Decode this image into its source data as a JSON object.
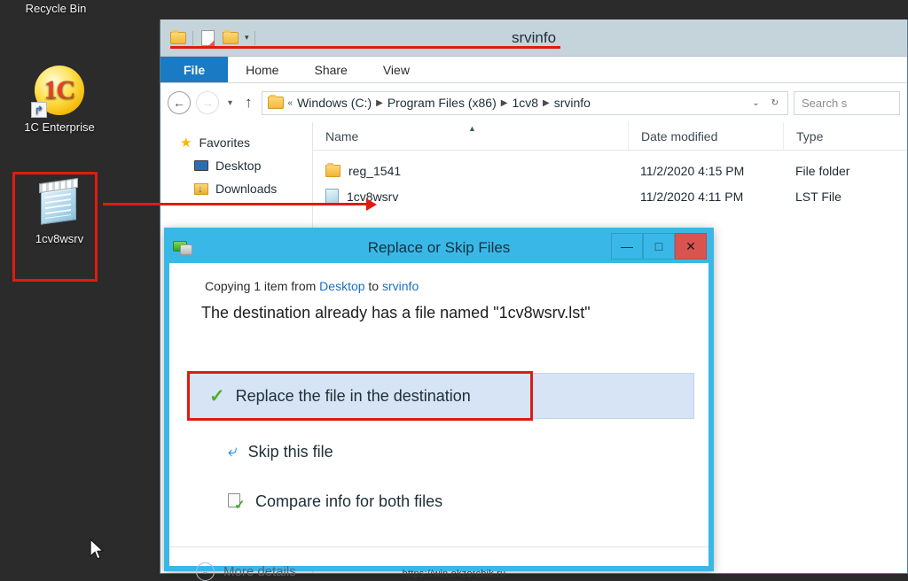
{
  "desktop": {
    "background_color": "#2b2b2b",
    "icons": [
      {
        "label": "Recycle Bin",
        "icon": "recycle-bin-icon"
      },
      {
        "label": "1C Enterprise",
        "icon": "1c-enterprise-icon",
        "logo_text": "1C",
        "shortcut_badge": "↱"
      },
      {
        "label": "1cv8wsrv",
        "icon": "lst-file-icon",
        "selected": true
      }
    ],
    "cursor": "mouse-pointer"
  },
  "explorer": {
    "title": "srvinfo",
    "quick_access": [
      {
        "name": "folder-icon"
      },
      {
        "name": "new-document-icon"
      },
      {
        "name": "folder-properties-icon"
      },
      {
        "name": "customize-caret-icon",
        "glyph": "▾"
      }
    ],
    "ribbon_tabs": [
      {
        "label": "File",
        "active": true
      },
      {
        "label": "Home",
        "active": false
      },
      {
        "label": "Share",
        "active": false
      },
      {
        "label": "View",
        "active": false
      }
    ],
    "nav": {
      "back": "←",
      "forward": "→",
      "recent_caret": "▾",
      "up": "↑"
    },
    "address": {
      "prefix": "«",
      "crumbs": [
        "Windows (C:)",
        "Program Files (x86)",
        "1cv8",
        "srvinfo"
      ],
      "separator": "▶",
      "dropdown": "⌄",
      "refresh": "↻"
    },
    "search": {
      "placeholder": "Search s"
    },
    "nav_pane": [
      {
        "label": "Favorites",
        "icon": "star-icon",
        "level": 0
      },
      {
        "label": "Desktop",
        "icon": "desktop-icon",
        "level": 1
      },
      {
        "label": "Downloads",
        "icon": "downloads-icon",
        "level": 1
      }
    ],
    "columns": [
      "Name",
      "Date modified",
      "Type"
    ],
    "sort_arrow": "▲",
    "rows": [
      {
        "name": "reg_1541",
        "date": "11/2/2020 4:15 PM",
        "type": "File folder",
        "icon": "folder-icon"
      },
      {
        "name": "1cv8wsrv",
        "date": "11/2/2020 4:11 PM",
        "type": "LST File",
        "icon": "lst-file-icon"
      }
    ]
  },
  "dialog": {
    "title": "Replace or Skip Files",
    "icon": "copy-files-icon",
    "window_controls": {
      "minimize": "—",
      "maximize": "□",
      "close": "✕"
    },
    "copying_prefix": "Copying 1 item from",
    "copying_source": "Desktop",
    "copying_middle": "to",
    "copying_target": "srvinfo",
    "destination_message": "The destination already has a file named \"1cv8wsrv.lst\"",
    "options": [
      {
        "label": "Replace the file in the destination",
        "icon": "green-check-icon",
        "highlighted": true
      },
      {
        "label": "Skip this file",
        "icon": "skip-arrow-icon",
        "highlighted": false
      },
      {
        "label": "Compare info for both files",
        "icon": "compare-files-icon",
        "highlighted": false
      }
    ],
    "more_details": {
      "label": "More details",
      "icon": "chevron-down-icon",
      "glyph": "⌄"
    }
  },
  "annotations": {
    "highlight_color": "#e01b12",
    "arrow_desktop_to_file": "arrow-desktop-icon-to-filelist",
    "underline_address": "address-path-underline"
  },
  "watermark": "https://win.ekzorchik.ru"
}
